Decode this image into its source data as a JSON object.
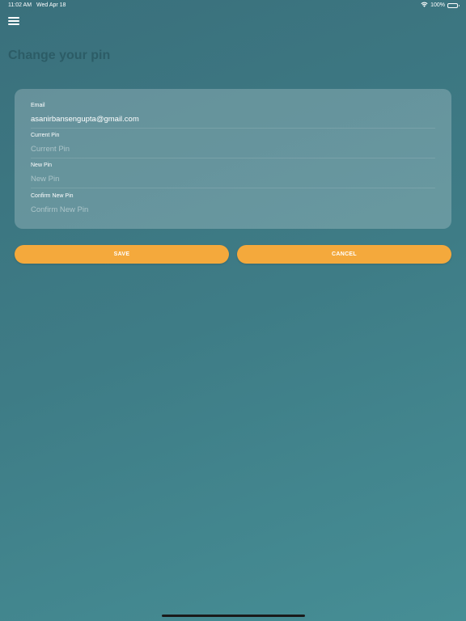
{
  "status_bar": {
    "time": "11:02 AM",
    "date": "Wed Apr 18",
    "battery": "100%",
    "icons": [
      "wifi-icon",
      "battery-icon"
    ]
  },
  "header": {
    "menu_icon": "hamburger-menu-icon",
    "title": "Change your pin"
  },
  "form": {
    "email": {
      "label": "Email",
      "value": "asanirbansengupta@gmail.com",
      "placeholder": ""
    },
    "current_pin": {
      "label": "Current Pin",
      "value": "",
      "placeholder": "Current Pin"
    },
    "new_pin": {
      "label": "New Pin",
      "value": "",
      "placeholder": "New Pin"
    },
    "confirm_pin": {
      "label": "Confirm New Pin",
      "value": "",
      "placeholder": "Confirm New Pin"
    }
  },
  "actions": {
    "save_label": "SAVE",
    "cancel_label": "CANCEL"
  },
  "colors": {
    "background_start": "#3a707c",
    "background_end": "#468e95",
    "title": "#2c5c66",
    "button": "#f4a93c"
  }
}
